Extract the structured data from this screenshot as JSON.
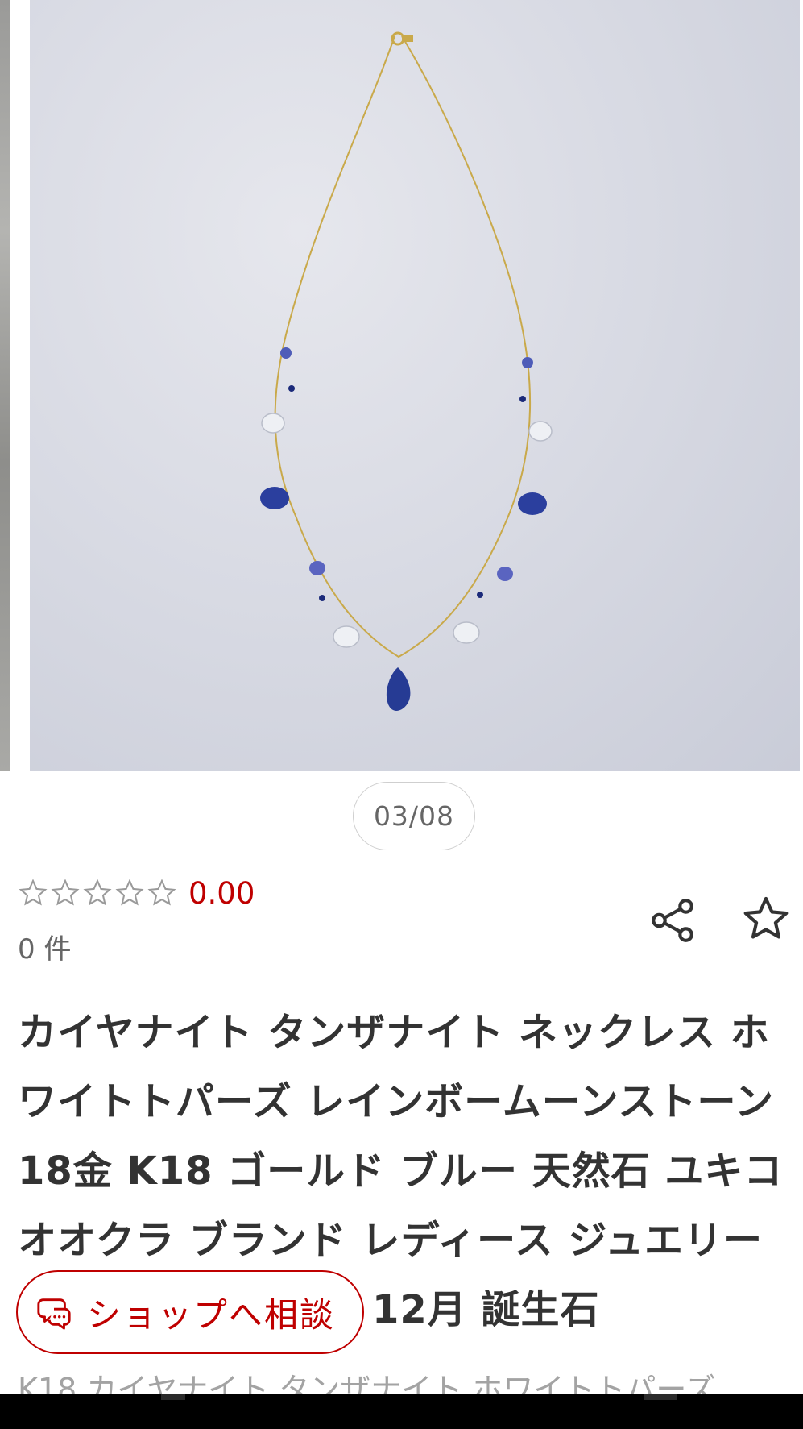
{
  "gallery": {
    "pager_text": "03/08"
  },
  "rating": {
    "value": "0.00",
    "count_text": "0 件",
    "stars_filled": 0,
    "stars_total": 5
  },
  "actions": {
    "share_icon": "share-icon",
    "favorite_icon": "star-outline-icon"
  },
  "product": {
    "title_lines": [
      "カイヤナイト タンザナイト ネックレス ホ",
      "ワイトトパーズ レインボームーンストーン",
      "18金 K18 ゴールド ブルー 天然石 ユキコ",
      "オオクラ ブランド レディース ジュエリー",
      "12月 誕生石"
    ],
    "subtitle": "K18 カイヤナイト タンザナイト ホワイトトパーズ"
  },
  "contact_button": {
    "label": "ショップへ相談",
    "icon": "chat-bubble-icon"
  },
  "colors": {
    "accent": "#bf0000",
    "text": "#333333",
    "muted": "#666666"
  }
}
